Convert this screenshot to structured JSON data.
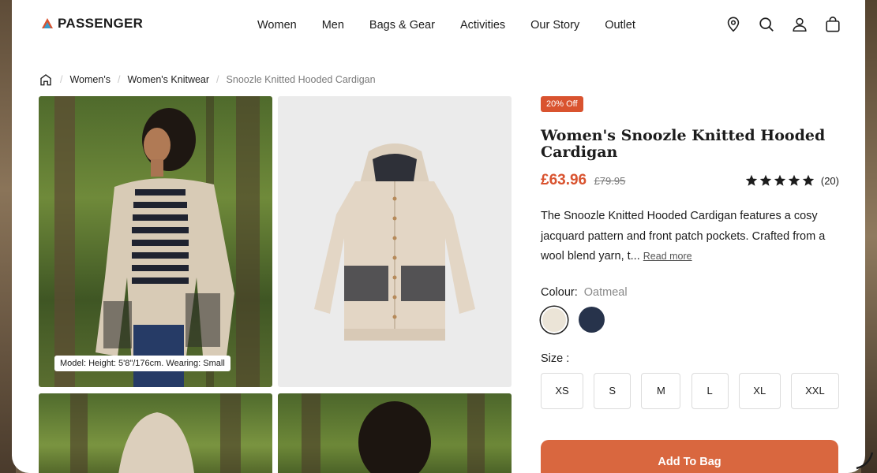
{
  "brand": {
    "name": "PASSENGER"
  },
  "nav": [
    "Women",
    "Men",
    "Bags & Gear",
    "Activities",
    "Our Story",
    "Outlet"
  ],
  "header_icons": [
    "location-pin-icon",
    "search-icon",
    "user-icon",
    "bag-icon"
  ],
  "breadcrumb": {
    "home_icon": "home-icon",
    "items": [
      "Women's",
      "Women's Knitwear"
    ],
    "current": "Snoozle Knitted Hooded Cardigan"
  },
  "gallery": {
    "model_caption": "Model: Height: 5'8\"/176cm. Wearing: Small"
  },
  "product": {
    "badge": "20% Off",
    "title": "Women's Snoozle Knitted Hooded Cardigan",
    "price": "£63.96",
    "old_price": "£79.95",
    "rating_stars": 5,
    "rating_count": "(20)",
    "description": "The Snoozle Knitted Hooded Cardigan features a cosy jacquard pattern and front patch pockets. Crafted from a wool blend yarn, t...",
    "read_more": "Read more",
    "colour_label": "Colour:",
    "colour_value": "Oatmeal",
    "swatches": [
      {
        "name": "Oatmeal",
        "color": "#ebe4d7"
      },
      {
        "name": "Navy",
        "color": "#27334b"
      }
    ],
    "size_label": "Size :",
    "sizes": [
      "XS",
      "S",
      "M",
      "L",
      "XL",
      "XXL"
    ],
    "add_to_bag": "Add To Bag"
  },
  "colors": {
    "accent": "#d9532f",
    "button": "#d9673f"
  }
}
